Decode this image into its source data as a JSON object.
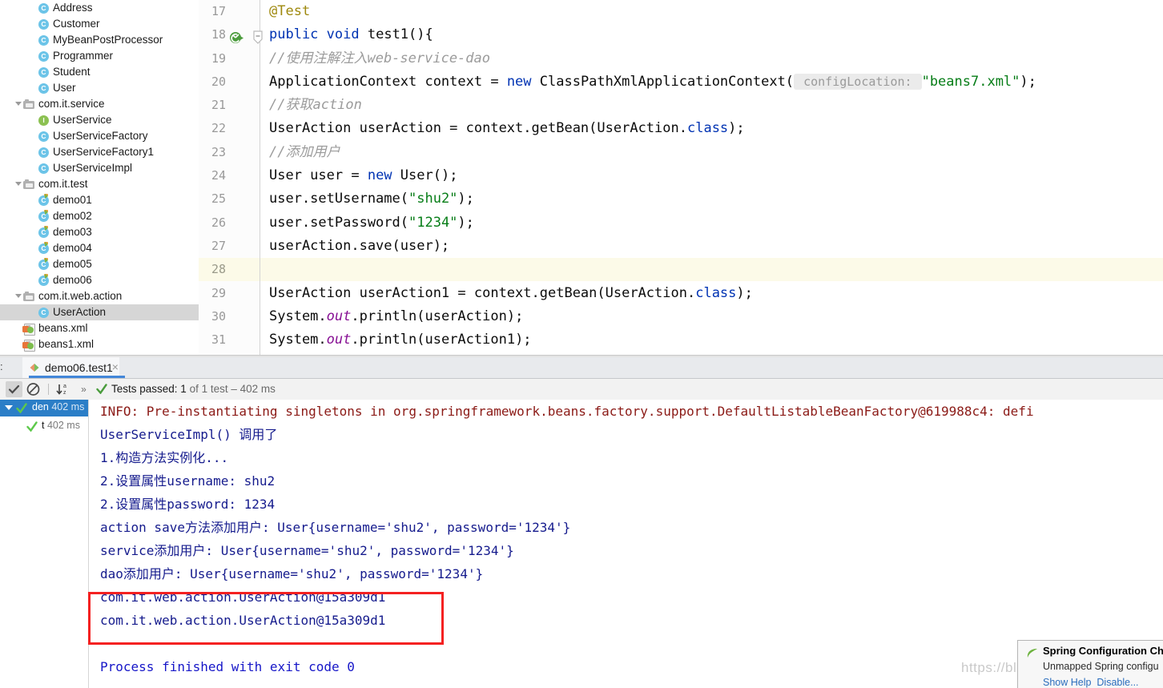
{
  "project_tree": {
    "items": [
      {
        "label": "Address",
        "type": "class",
        "indent": 3
      },
      {
        "label": "Customer",
        "type": "class",
        "indent": 3
      },
      {
        "label": "MyBeanPostProcessor",
        "type": "class",
        "indent": 3
      },
      {
        "label": "Programmer",
        "type": "class",
        "indent": 3
      },
      {
        "label": "Student",
        "type": "class",
        "indent": 3
      },
      {
        "label": "User",
        "type": "class",
        "indent": 3
      },
      {
        "label": "com.it.service",
        "type": "package",
        "indent": 2,
        "expanded": true
      },
      {
        "label": "UserService",
        "type": "interface",
        "indent": 3
      },
      {
        "label": "UserServiceFactory",
        "type": "class",
        "indent": 3
      },
      {
        "label": "UserServiceFactory1",
        "type": "class",
        "indent": 3
      },
      {
        "label": "UserServiceImpl",
        "type": "class",
        "indent": 3
      },
      {
        "label": "com.it.test",
        "type": "package",
        "indent": 2,
        "expanded": true
      },
      {
        "label": "demo01",
        "type": "class-run",
        "indent": 3
      },
      {
        "label": "demo02",
        "type": "class-run",
        "indent": 3
      },
      {
        "label": "demo03",
        "type": "class-run",
        "indent": 3
      },
      {
        "label": "demo04",
        "type": "class-run",
        "indent": 3
      },
      {
        "label": "demo05",
        "type": "class-run",
        "indent": 3
      },
      {
        "label": "demo06",
        "type": "class-run",
        "indent": 3
      },
      {
        "label": "com.it.web.action",
        "type": "package",
        "indent": 2,
        "expanded": true
      },
      {
        "label": "UserAction",
        "type": "class",
        "indent": 3,
        "selected": true
      },
      {
        "label": "beans.xml",
        "type": "xml",
        "indent": 2
      },
      {
        "label": "beans1.xml",
        "type": "xml",
        "indent": 2
      }
    ]
  },
  "editor": {
    "lines": [
      {
        "num": "17",
        "tokens": [
          {
            "t": "        ",
            "c": ""
          },
          {
            "t": "@Test",
            "c": "ann"
          }
        ]
      },
      {
        "num": "18",
        "tokens": [
          {
            "t": "        ",
            "c": ""
          },
          {
            "t": "public",
            "c": "kw"
          },
          {
            "t": " ",
            "c": ""
          },
          {
            "t": "void",
            "c": "kw"
          },
          {
            "t": " test1(){",
            "c": ""
          }
        ],
        "gutter_run": true,
        "gutter_fold": true
      },
      {
        "num": "19",
        "tokens": [
          {
            "t": "            ",
            "c": ""
          },
          {
            "t": "//使用注解注入web-service-dao",
            "c": "cmt"
          }
        ]
      },
      {
        "num": "20",
        "tokens": [
          {
            "t": "            ApplicationContext context = ",
            "c": ""
          },
          {
            "t": "new",
            "c": "kw"
          },
          {
            "t": " ClassPathXmlApplicationContext(",
            "c": ""
          },
          {
            "t": " configLocation: ",
            "c": "hint"
          },
          {
            "t": "\"beans7.xml\"",
            "c": "str"
          },
          {
            "t": ");",
            "c": ""
          }
        ]
      },
      {
        "num": "21",
        "tokens": [
          {
            "t": "            ",
            "c": ""
          },
          {
            "t": "//获取action",
            "c": "cmt"
          }
        ]
      },
      {
        "num": "22",
        "tokens": [
          {
            "t": "            UserAction userAction = context.getBean(UserAction.",
            "c": ""
          },
          {
            "t": "class",
            "c": "kw"
          },
          {
            "t": ");",
            "c": ""
          }
        ]
      },
      {
        "num": "23",
        "tokens": [
          {
            "t": "            ",
            "c": ""
          },
          {
            "t": "//添加用户",
            "c": "cmt"
          }
        ]
      },
      {
        "num": "24",
        "tokens": [
          {
            "t": "            User user = ",
            "c": ""
          },
          {
            "t": "new",
            "c": "kw"
          },
          {
            "t": " User();",
            "c": ""
          }
        ]
      },
      {
        "num": "25",
        "tokens": [
          {
            "t": "            user.setUsername(",
            "c": ""
          },
          {
            "t": "\"shu2\"",
            "c": "str"
          },
          {
            "t": ");",
            "c": ""
          }
        ]
      },
      {
        "num": "26",
        "tokens": [
          {
            "t": "            user.setPassword(",
            "c": ""
          },
          {
            "t": "\"1234\"",
            "c": "str"
          },
          {
            "t": ");",
            "c": ""
          }
        ]
      },
      {
        "num": "27",
        "tokens": [
          {
            "t": "            userAction.save(user);",
            "c": ""
          }
        ]
      },
      {
        "num": "28",
        "tokens": [
          {
            "t": "",
            "c": ""
          }
        ],
        "current": true
      },
      {
        "num": "29",
        "tokens": [
          {
            "t": "            UserAction userAction1 = context.getBean(UserAction.",
            "c": ""
          },
          {
            "t": "class",
            "c": "kw"
          },
          {
            "t": ");",
            "c": ""
          }
        ]
      },
      {
        "num": "30",
        "tokens": [
          {
            "t": "            System.",
            "c": ""
          },
          {
            "t": "out",
            "c": "fld"
          },
          {
            "t": ".println(userAction);",
            "c": ""
          }
        ]
      },
      {
        "num": "31",
        "tokens": [
          {
            "t": "            System.",
            "c": ""
          },
          {
            "t": "out",
            "c": "fld"
          },
          {
            "t": ".println(userAction1);",
            "c": ""
          }
        ]
      }
    ]
  },
  "run_panel": {
    "tab_prefix": ":",
    "tab_label": "demo06.test1",
    "tab_close": "×",
    "toolbar": {
      "status_prefix": "Tests passed: ",
      "status_count": "1",
      "status_suffix": " of 1 test – 402 ms",
      "expand_all_icon": "checkmark-icon",
      "hide_passed_icon": "no-entry-icon",
      "sort_icon": "sort-alpha-icon",
      "more_icon": "»"
    },
    "test_tree": [
      {
        "label": "den",
        "time": "402 ms",
        "selected": true
      },
      {
        "label": "t",
        "time": "402 ms",
        "selected": false
      }
    ],
    "console_lines": [
      {
        "text": "INFO: Pre-instantiating singletons in org.springframework.beans.factory.support.DefaultListableBeanFactory@619988c4: defi",
        "color": "red"
      },
      {
        "text": "UserServiceImpl() 调用了",
        "color": "blue"
      },
      {
        "text": "1.构造方法实例化...",
        "color": "blue"
      },
      {
        "text": "2.设置属性username: shu2",
        "color": "blue"
      },
      {
        "text": "2.设置属性password: 1234",
        "color": "blue"
      },
      {
        "text": "action save方法添加用户: User{username='shu2', password='1234'}",
        "color": "blue"
      },
      {
        "text": "service添加用户: User{username='shu2', password='1234'}",
        "color": "blue"
      },
      {
        "text": "dao添加用户: User{username='shu2', password='1234'}",
        "color": "blue"
      },
      {
        "text": "com.it.web.action.UserAction@15a309d1",
        "color": "blue"
      },
      {
        "text": "com.it.web.action.UserAction@15a309d1",
        "color": "blue"
      },
      {
        "text": "",
        "color": "blue"
      },
      {
        "text": "Process finished with exit code 0",
        "color": "proc"
      }
    ]
  },
  "notification": {
    "title": "Spring Configuration Che",
    "body": "Unmapped Spring configu",
    "link_help": "Show Help",
    "link_disable": "Disable...",
    "icon": "spring-leaf-icon"
  },
  "watermark": "https://blog.csdn.net/qq_",
  "colors": {
    "accent_blue": "#2b7ec7",
    "selection_gray": "#d6d6d6",
    "annotation_red": "#f42121",
    "current_line": "#fcfae8",
    "keyword": "#0033b3",
    "string": "#067d17",
    "comment": "#9b9b9b"
  }
}
